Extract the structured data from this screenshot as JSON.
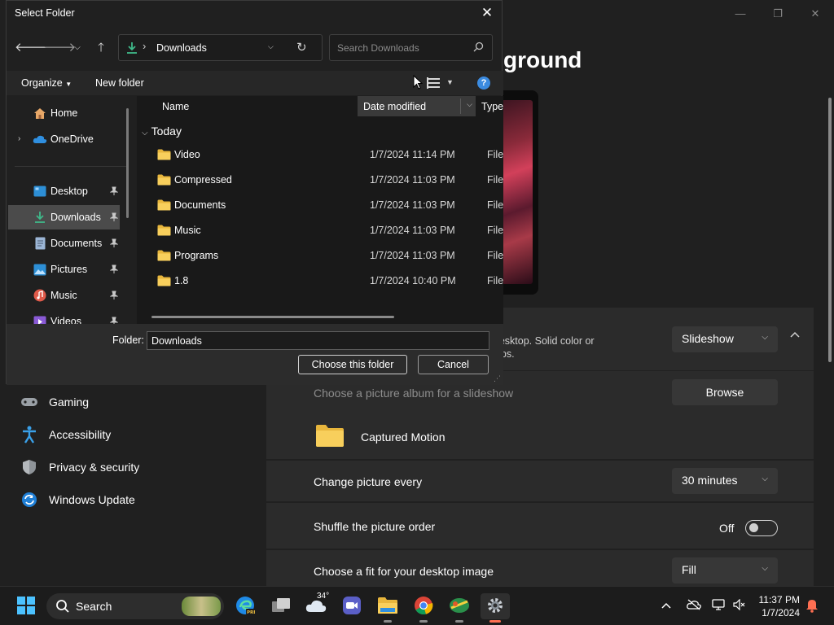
{
  "settings": {
    "heading": "ground",
    "background_row": {
      "sub_line1": "nt desktop. Solid color or",
      "sub_line2": "sktops.",
      "value": "Slideshow"
    },
    "album_row": {
      "label": "Choose a picture album for a slideshow",
      "button": "Browse"
    },
    "album_name": "Captured Motion",
    "change_row": {
      "label": "Change picture every",
      "value": "30 minutes"
    },
    "shuffle_row": {
      "label": "Shuffle the picture order",
      "state": "Off"
    },
    "fit_row": {
      "label": "Choose a fit for your desktop image",
      "value": "Fill"
    },
    "nav": [
      {
        "label": "Gaming",
        "icon": "gamepad-icon"
      },
      {
        "label": "Accessibility",
        "icon": "accessibility-icon"
      },
      {
        "label": "Privacy & security",
        "icon": "shield-icon"
      },
      {
        "label": "Windows Update",
        "icon": "update-icon"
      }
    ]
  },
  "dialog": {
    "title": "Select Folder",
    "address": {
      "path": "Downloads"
    },
    "search_placeholder": "Search Downloads",
    "toolbar": {
      "organize": "Organize",
      "new_folder": "New folder"
    },
    "nav_pane": [
      {
        "label": "Home",
        "icon": "home-icon"
      },
      {
        "label": "OneDrive",
        "icon": "cloud-icon"
      },
      {
        "label": "Desktop",
        "icon": "desktop-icon",
        "pinned": true
      },
      {
        "label": "Downloads",
        "icon": "download-icon",
        "pinned": true,
        "selected": true
      },
      {
        "label": "Documents",
        "icon": "document-icon",
        "pinned": true
      },
      {
        "label": "Pictures",
        "icon": "pictures-icon",
        "pinned": true
      },
      {
        "label": "Music",
        "icon": "music-icon",
        "pinned": true
      },
      {
        "label": "Videos",
        "icon": "videos-icon",
        "pinned": true
      }
    ],
    "columns": {
      "name": "Name",
      "date": "Date modified",
      "type": "Type"
    },
    "group": "Today",
    "files": [
      {
        "name": "Video",
        "date": "1/7/2024 11:14 PM",
        "type": "File fo"
      },
      {
        "name": "Compressed",
        "date": "1/7/2024 11:03 PM",
        "type": "File fo"
      },
      {
        "name": "Documents",
        "date": "1/7/2024 11:03 PM",
        "type": "File fo"
      },
      {
        "name": "Music",
        "date": "1/7/2024 11:03 PM",
        "type": "File fo"
      },
      {
        "name": "Programs",
        "date": "1/7/2024 11:03 PM",
        "type": "File fo"
      },
      {
        "name": "1.8",
        "date": "1/7/2024 10:40 PM",
        "type": "File fo"
      }
    ],
    "folder_label": "Folder:",
    "folder_value": "Downloads",
    "choose_button": "Choose this folder",
    "cancel_button": "Cancel"
  },
  "taskbar": {
    "search": "Search",
    "weather_temp": "34°",
    "time": "11:37 PM",
    "date": "1/7/2024"
  },
  "colors": {
    "accent": "#3b8be0",
    "folder": "#f4c34a",
    "download": "#3fb98a",
    "active_indicator": "#ff6f52"
  }
}
